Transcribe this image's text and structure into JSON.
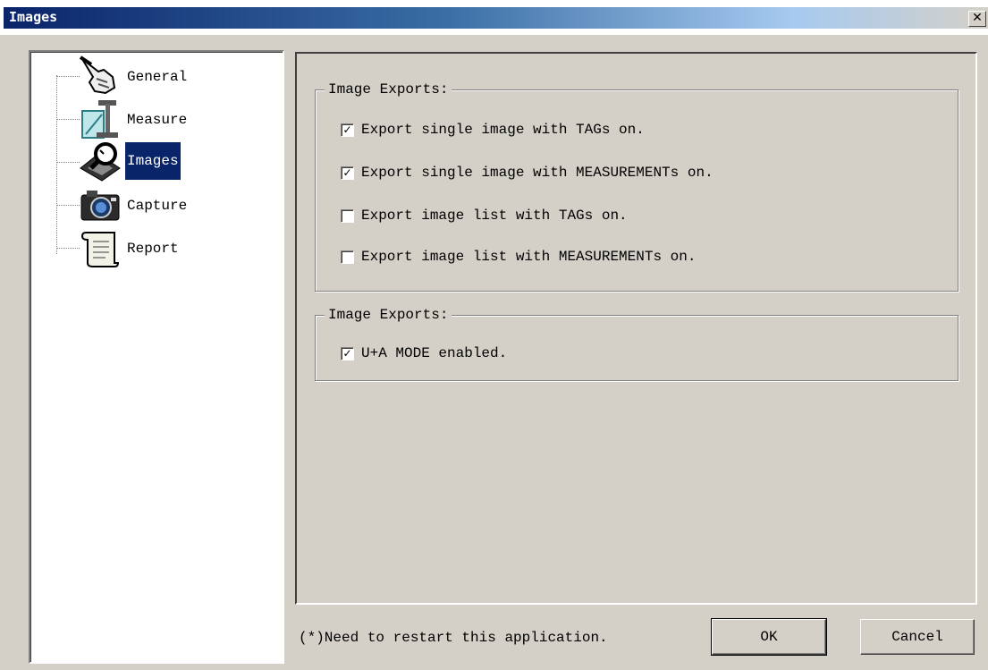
{
  "window": {
    "title": "Images",
    "close_glyph": "✕"
  },
  "tree": {
    "items": [
      {
        "label": "General",
        "icon": "pointing-hand-icon"
      },
      {
        "label": "Measure",
        "icon": "measure-icon"
      },
      {
        "label": "Images",
        "icon": "magnifier-images-icon",
        "selected": true
      },
      {
        "label": "Capture",
        "icon": "camera-icon"
      },
      {
        "label": "Report",
        "icon": "scroll-icon"
      }
    ]
  },
  "groups": [
    {
      "legend": "Image Exports:",
      "options": [
        {
          "label": "Export single image with TAGs on.",
          "checked": true
        },
        {
          "label": "Export single image with MEASUREMENTs on.",
          "checked": true
        },
        {
          "label": "Export image list with TAGs on.",
          "checked": false
        },
        {
          "label": "Export image list with MEASUREMENTs on.",
          "checked": false
        }
      ]
    },
    {
      "legend": "Image Exports:",
      "options": [
        {
          "label": "U+A MODE enabled.",
          "checked": true
        }
      ]
    }
  ],
  "footer": {
    "note": "(*)Need to restart this application."
  },
  "buttons": {
    "ok": "OK",
    "cancel": "Cancel"
  },
  "colors": {
    "title_bar": "#0a246a",
    "face": "#d4d0c8",
    "selection": "#0a246a"
  }
}
